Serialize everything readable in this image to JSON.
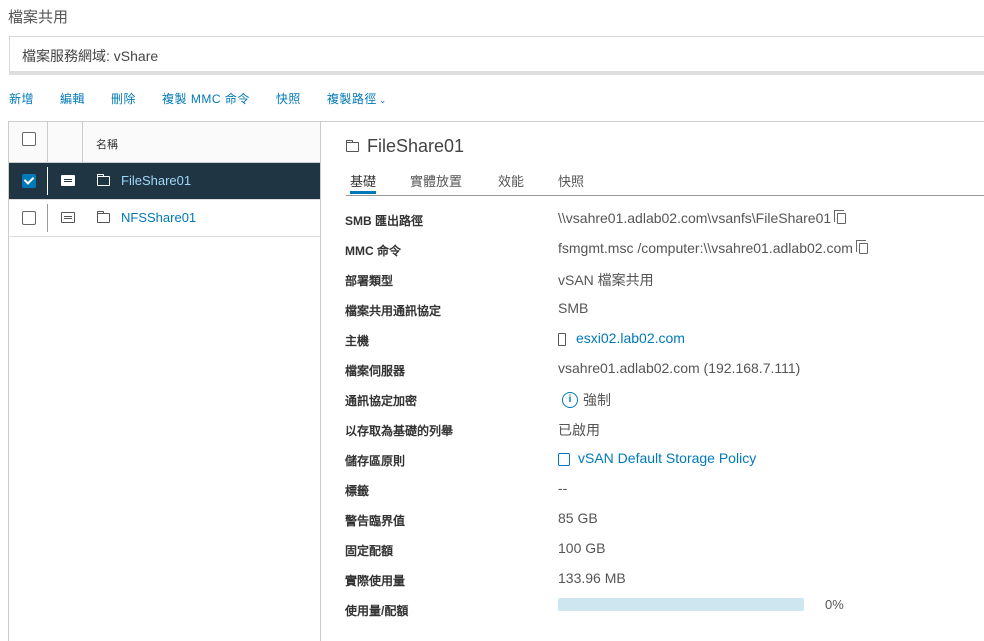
{
  "page_title": "檔案共用",
  "domain_bar": {
    "text": "檔案服務網域: vShare"
  },
  "toolbar": {
    "items": [
      "新增",
      "編輯",
      "刪除",
      "複製 MMC 命令",
      "快照",
      "複製路徑"
    ]
  },
  "grid": {
    "header": {
      "name_col": "名稱"
    },
    "rows": [
      {
        "name": "FileShare01",
        "selected": true
      },
      {
        "name": "NFSShare01",
        "selected": false
      }
    ]
  },
  "detail": {
    "title": "FileShare01",
    "tabs": [
      "基礎",
      "實體放置",
      "效能",
      "快照"
    ],
    "active_tab": "基礎",
    "properties": [
      {
        "label": "SMB 匯出路徑",
        "value": "\\\\vsahre01.adlab02.com\\vsanfs\\FileShare01"
      },
      {
        "label": "MMC 命令",
        "value": "fsmgmt.msc /computer:\\\\vsahre01.adlab02.com"
      },
      {
        "label": "部署類型",
        "value": "vSAN 檔案共用"
      },
      {
        "label": "檔案共用通訊協定",
        "value": "SMB"
      },
      {
        "label": "主機",
        "value": "esxi02.lab02.com"
      },
      {
        "label": "檔案伺服器",
        "value": "vsahre01.adlab02.com (192.168.7.111)"
      },
      {
        "label": "通訊協定加密",
        "value": "強制"
      },
      {
        "label": "以存取為基礎的列舉",
        "value": "已啟用"
      },
      {
        "label": "儲存區原則",
        "value": "vSAN Default Storage Policy"
      },
      {
        "label": "標籤",
        "value": "--"
      },
      {
        "label": "警告臨界值",
        "value": "85 GB"
      },
      {
        "label": "固定配額",
        "value": "100 GB"
      },
      {
        "label": "實際使用量",
        "value": "133.96 MB"
      },
      {
        "label": "使用量/配額",
        "value": "0%"
      }
    ],
    "usage_fraction": 0.0
  },
  "colors": {
    "accent": "#0079b8",
    "selected_row": "#1f3544",
    "progress_track": "#cde6f0"
  }
}
